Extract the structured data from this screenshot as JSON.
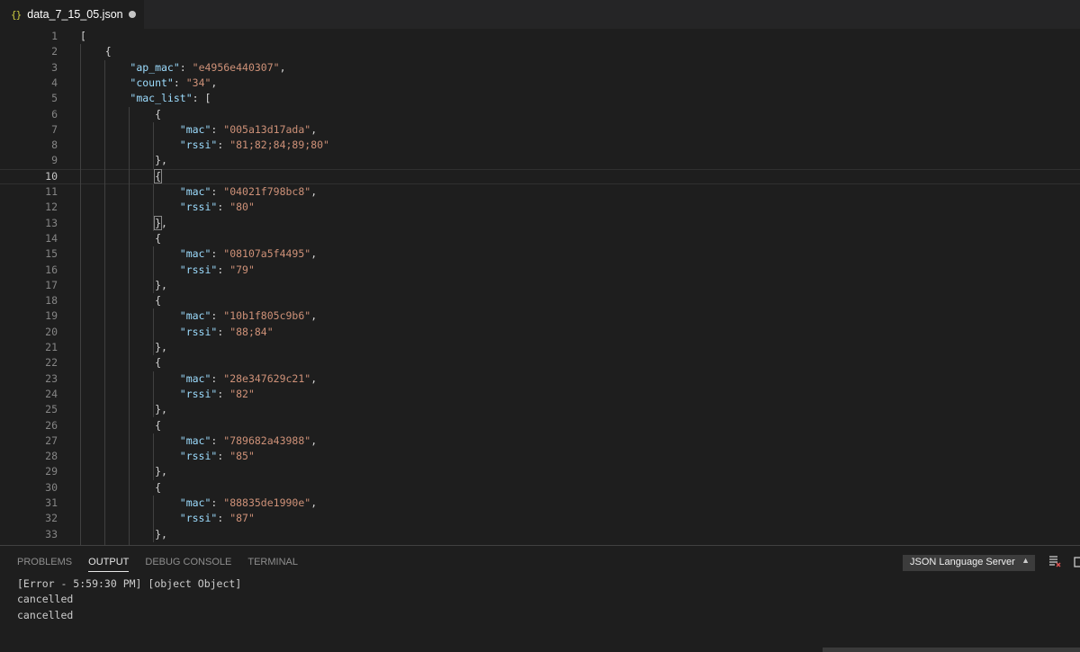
{
  "tab": {
    "icon": "{}",
    "title": "data_7_15_05.json"
  },
  "editor": {
    "lines": [
      {
        "n": "1",
        "tokens": [
          {
            "t": "p",
            "v": "["
          }
        ]
      },
      {
        "n": "2",
        "tokens": [
          {
            "t": "p",
            "v": "    {"
          }
        ]
      },
      {
        "n": "3",
        "tokens": [
          {
            "t": "p",
            "v": "        "
          },
          {
            "t": "k",
            "v": "\"ap_mac\""
          },
          {
            "t": "p",
            "v": ": "
          },
          {
            "t": "s",
            "v": "\"e4956e440307\""
          },
          {
            "t": "p",
            "v": ","
          }
        ]
      },
      {
        "n": "4",
        "tokens": [
          {
            "t": "p",
            "v": "        "
          },
          {
            "t": "k",
            "v": "\"count\""
          },
          {
            "t": "p",
            "v": ": "
          },
          {
            "t": "s",
            "v": "\"34\""
          },
          {
            "t": "p",
            "v": ","
          }
        ]
      },
      {
        "n": "5",
        "tokens": [
          {
            "t": "p",
            "v": "        "
          },
          {
            "t": "k",
            "v": "\"mac_list\""
          },
          {
            "t": "p",
            "v": ": ["
          }
        ]
      },
      {
        "n": "6",
        "tokens": [
          {
            "t": "p",
            "v": "            {"
          }
        ]
      },
      {
        "n": "7",
        "tokens": [
          {
            "t": "p",
            "v": "                "
          },
          {
            "t": "k",
            "v": "\"mac\""
          },
          {
            "t": "p",
            "v": ": "
          },
          {
            "t": "s",
            "v": "\"005a13d17ada\""
          },
          {
            "t": "p",
            "v": ","
          }
        ]
      },
      {
        "n": "8",
        "tokens": [
          {
            "t": "p",
            "v": "                "
          },
          {
            "t": "k",
            "v": "\"rssi\""
          },
          {
            "t": "p",
            "v": ": "
          },
          {
            "t": "s",
            "v": "\"81;82;84;89;80\""
          }
        ]
      },
      {
        "n": "9",
        "tokens": [
          {
            "t": "p",
            "v": "            },"
          }
        ]
      },
      {
        "n": "10",
        "current": true,
        "tokens": [
          {
            "t": "p",
            "v": "            "
          },
          {
            "t": "b",
            "v": "{"
          }
        ]
      },
      {
        "n": "11",
        "tokens": [
          {
            "t": "p",
            "v": "                "
          },
          {
            "t": "k",
            "v": "\"mac\""
          },
          {
            "t": "p",
            "v": ": "
          },
          {
            "t": "s",
            "v": "\"04021f798bc8\""
          },
          {
            "t": "p",
            "v": ","
          }
        ]
      },
      {
        "n": "12",
        "tokens": [
          {
            "t": "p",
            "v": "                "
          },
          {
            "t": "k",
            "v": "\"rssi\""
          },
          {
            "t": "p",
            "v": ": "
          },
          {
            "t": "s",
            "v": "\"80\""
          }
        ]
      },
      {
        "n": "13",
        "tokens": [
          {
            "t": "p",
            "v": "            "
          },
          {
            "t": "b",
            "v": "}"
          },
          {
            "t": "p",
            "v": ","
          }
        ]
      },
      {
        "n": "14",
        "tokens": [
          {
            "t": "p",
            "v": "            {"
          }
        ]
      },
      {
        "n": "15",
        "tokens": [
          {
            "t": "p",
            "v": "                "
          },
          {
            "t": "k",
            "v": "\"mac\""
          },
          {
            "t": "p",
            "v": ": "
          },
          {
            "t": "s",
            "v": "\"08107a5f4495\""
          },
          {
            "t": "p",
            "v": ","
          }
        ]
      },
      {
        "n": "16",
        "tokens": [
          {
            "t": "p",
            "v": "                "
          },
          {
            "t": "k",
            "v": "\"rssi\""
          },
          {
            "t": "p",
            "v": ": "
          },
          {
            "t": "s",
            "v": "\"79\""
          }
        ]
      },
      {
        "n": "17",
        "tokens": [
          {
            "t": "p",
            "v": "            },"
          }
        ]
      },
      {
        "n": "18",
        "tokens": [
          {
            "t": "p",
            "v": "            {"
          }
        ]
      },
      {
        "n": "19",
        "tokens": [
          {
            "t": "p",
            "v": "                "
          },
          {
            "t": "k",
            "v": "\"mac\""
          },
          {
            "t": "p",
            "v": ": "
          },
          {
            "t": "s",
            "v": "\"10b1f805c9b6\""
          },
          {
            "t": "p",
            "v": ","
          }
        ]
      },
      {
        "n": "20",
        "tokens": [
          {
            "t": "p",
            "v": "                "
          },
          {
            "t": "k",
            "v": "\"rssi\""
          },
          {
            "t": "p",
            "v": ": "
          },
          {
            "t": "s",
            "v": "\"88;84\""
          }
        ]
      },
      {
        "n": "21",
        "tokens": [
          {
            "t": "p",
            "v": "            },"
          }
        ]
      },
      {
        "n": "22",
        "tokens": [
          {
            "t": "p",
            "v": "            {"
          }
        ]
      },
      {
        "n": "23",
        "tokens": [
          {
            "t": "p",
            "v": "                "
          },
          {
            "t": "k",
            "v": "\"mac\""
          },
          {
            "t": "p",
            "v": ": "
          },
          {
            "t": "s",
            "v": "\"28e347629c21\""
          },
          {
            "t": "p",
            "v": ","
          }
        ]
      },
      {
        "n": "24",
        "tokens": [
          {
            "t": "p",
            "v": "                "
          },
          {
            "t": "k",
            "v": "\"rssi\""
          },
          {
            "t": "p",
            "v": ": "
          },
          {
            "t": "s",
            "v": "\"82\""
          }
        ]
      },
      {
        "n": "25",
        "tokens": [
          {
            "t": "p",
            "v": "            },"
          }
        ]
      },
      {
        "n": "26",
        "tokens": [
          {
            "t": "p",
            "v": "            {"
          }
        ]
      },
      {
        "n": "27",
        "tokens": [
          {
            "t": "p",
            "v": "                "
          },
          {
            "t": "k",
            "v": "\"mac\""
          },
          {
            "t": "p",
            "v": ": "
          },
          {
            "t": "s",
            "v": "\"789682a43988\""
          },
          {
            "t": "p",
            "v": ","
          }
        ]
      },
      {
        "n": "28",
        "tokens": [
          {
            "t": "p",
            "v": "                "
          },
          {
            "t": "k",
            "v": "\"rssi\""
          },
          {
            "t": "p",
            "v": ": "
          },
          {
            "t": "s",
            "v": "\"85\""
          }
        ]
      },
      {
        "n": "29",
        "tokens": [
          {
            "t": "p",
            "v": "            },"
          }
        ]
      },
      {
        "n": "30",
        "tokens": [
          {
            "t": "p",
            "v": "            {"
          }
        ]
      },
      {
        "n": "31",
        "tokens": [
          {
            "t": "p",
            "v": "                "
          },
          {
            "t": "k",
            "v": "\"mac\""
          },
          {
            "t": "p",
            "v": ": "
          },
          {
            "t": "s",
            "v": "\"88835de1990e\""
          },
          {
            "t": "p",
            "v": ","
          }
        ]
      },
      {
        "n": "32",
        "tokens": [
          {
            "t": "p",
            "v": "                "
          },
          {
            "t": "k",
            "v": "\"rssi\""
          },
          {
            "t": "p",
            "v": ": "
          },
          {
            "t": "s",
            "v": "\"87\""
          }
        ]
      },
      {
        "n": "33",
        "tokens": [
          {
            "t": "p",
            "v": "            },"
          }
        ]
      }
    ]
  },
  "panel": {
    "tabs": [
      {
        "label": "PROBLEMS",
        "active": false
      },
      {
        "label": "OUTPUT",
        "active": true
      },
      {
        "label": "DEBUG CONSOLE",
        "active": false
      },
      {
        "label": "TERMINAL",
        "active": false
      }
    ],
    "selected_channel": "JSON Language Server",
    "output_lines": [
      "[Error - 5:59:30 PM] [object Object]",
      "cancelled",
      "cancelled"
    ],
    "actions": [
      "clear-output-icon",
      "new-window-icon"
    ]
  },
  "colors": {
    "background": "#1e1e1e",
    "key": "#9cdcfe",
    "string": "#ce9178",
    "punctuation": "#d4d4d4",
    "line_number": "#858585"
  }
}
